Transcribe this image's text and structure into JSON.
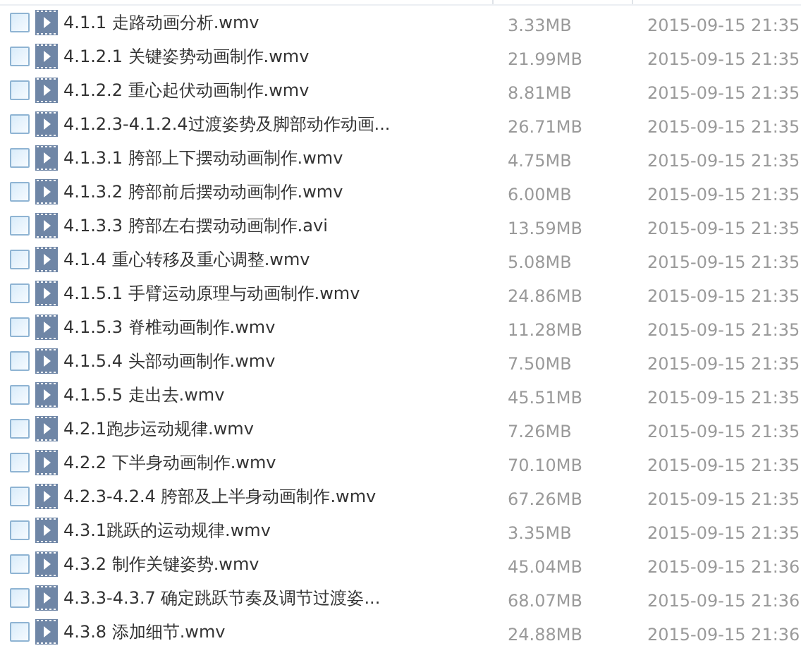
{
  "files": [
    {
      "name": "4.1.1 走路动画分析.wmv",
      "size": "3.33MB",
      "modified": "2015-09-15 21:35",
      "checked": false
    },
    {
      "name": "4.1.2.1 关键姿势动画制作.wmv",
      "size": "21.99MB",
      "modified": "2015-09-15 21:35",
      "checked": false
    },
    {
      "name": "4.1.2.2 重心起伏动画制作.wmv",
      "size": "8.81MB",
      "modified": "2015-09-15 21:35",
      "checked": false
    },
    {
      "name": "4.1.2.3-4.1.2.4过渡姿势及脚部动作动画...",
      "size": "26.71MB",
      "modified": "2015-09-15 21:35",
      "checked": false
    },
    {
      "name": "4.1.3.1 胯部上下摆动动画制作.wmv",
      "size": "4.75MB",
      "modified": "2015-09-15 21:35",
      "checked": false
    },
    {
      "name": "4.1.3.2 胯部前后摆动动画制作.wmv",
      "size": "6.00MB",
      "modified": "2015-09-15 21:35",
      "checked": false
    },
    {
      "name": "4.1.3.3 胯部左右摆动动画制作.avi",
      "size": "13.59MB",
      "modified": "2015-09-15 21:35",
      "checked": false
    },
    {
      "name": "4.1.4 重心转移及重心调整.wmv",
      "size": "5.08MB",
      "modified": "2015-09-15 21:35",
      "checked": false
    },
    {
      "name": "4.1.5.1 手臂运动原理与动画制作.wmv",
      "size": "24.86MB",
      "modified": "2015-09-15 21:35",
      "checked": false
    },
    {
      "name": "4.1.5.3 脊椎动画制作.wmv",
      "size": "11.28MB",
      "modified": "2015-09-15 21:35",
      "checked": false
    },
    {
      "name": "4.1.5.4 头部动画制作.wmv",
      "size": "7.50MB",
      "modified": "2015-09-15 21:35",
      "checked": false
    },
    {
      "name": "4.1.5.5 走出去.wmv",
      "size": "45.51MB",
      "modified": "2015-09-15 21:35",
      "checked": false
    },
    {
      "name": "4.2.1跑步运动规律.wmv",
      "size": "7.26MB",
      "modified": "2015-09-15 21:35",
      "checked": false
    },
    {
      "name": "4.2.2 下半身动画制作.wmv",
      "size": "70.10MB",
      "modified": "2015-09-15 21:35",
      "checked": false
    },
    {
      "name": "4.2.3-4.2.4 胯部及上半身动画制作.wmv",
      "size": "67.26MB",
      "modified": "2015-09-15 21:35",
      "checked": false
    },
    {
      "name": "4.3.1跳跃的运动规律.wmv",
      "size": "3.35MB",
      "modified": "2015-09-15 21:35",
      "checked": false
    },
    {
      "name": "4.3.2 制作关键姿势.wmv",
      "size": "45.04MB",
      "modified": "2015-09-15 21:36",
      "checked": false
    },
    {
      "name": "4.3.3-4.3.7 确定跳跃节奏及调节过渡姿...",
      "size": "68.07MB",
      "modified": "2015-09-15 21:36",
      "checked": false
    },
    {
      "name": "4.3.8 添加细节.wmv",
      "size": "24.88MB",
      "modified": "2015-09-15 21:36",
      "checked": false
    }
  ]
}
